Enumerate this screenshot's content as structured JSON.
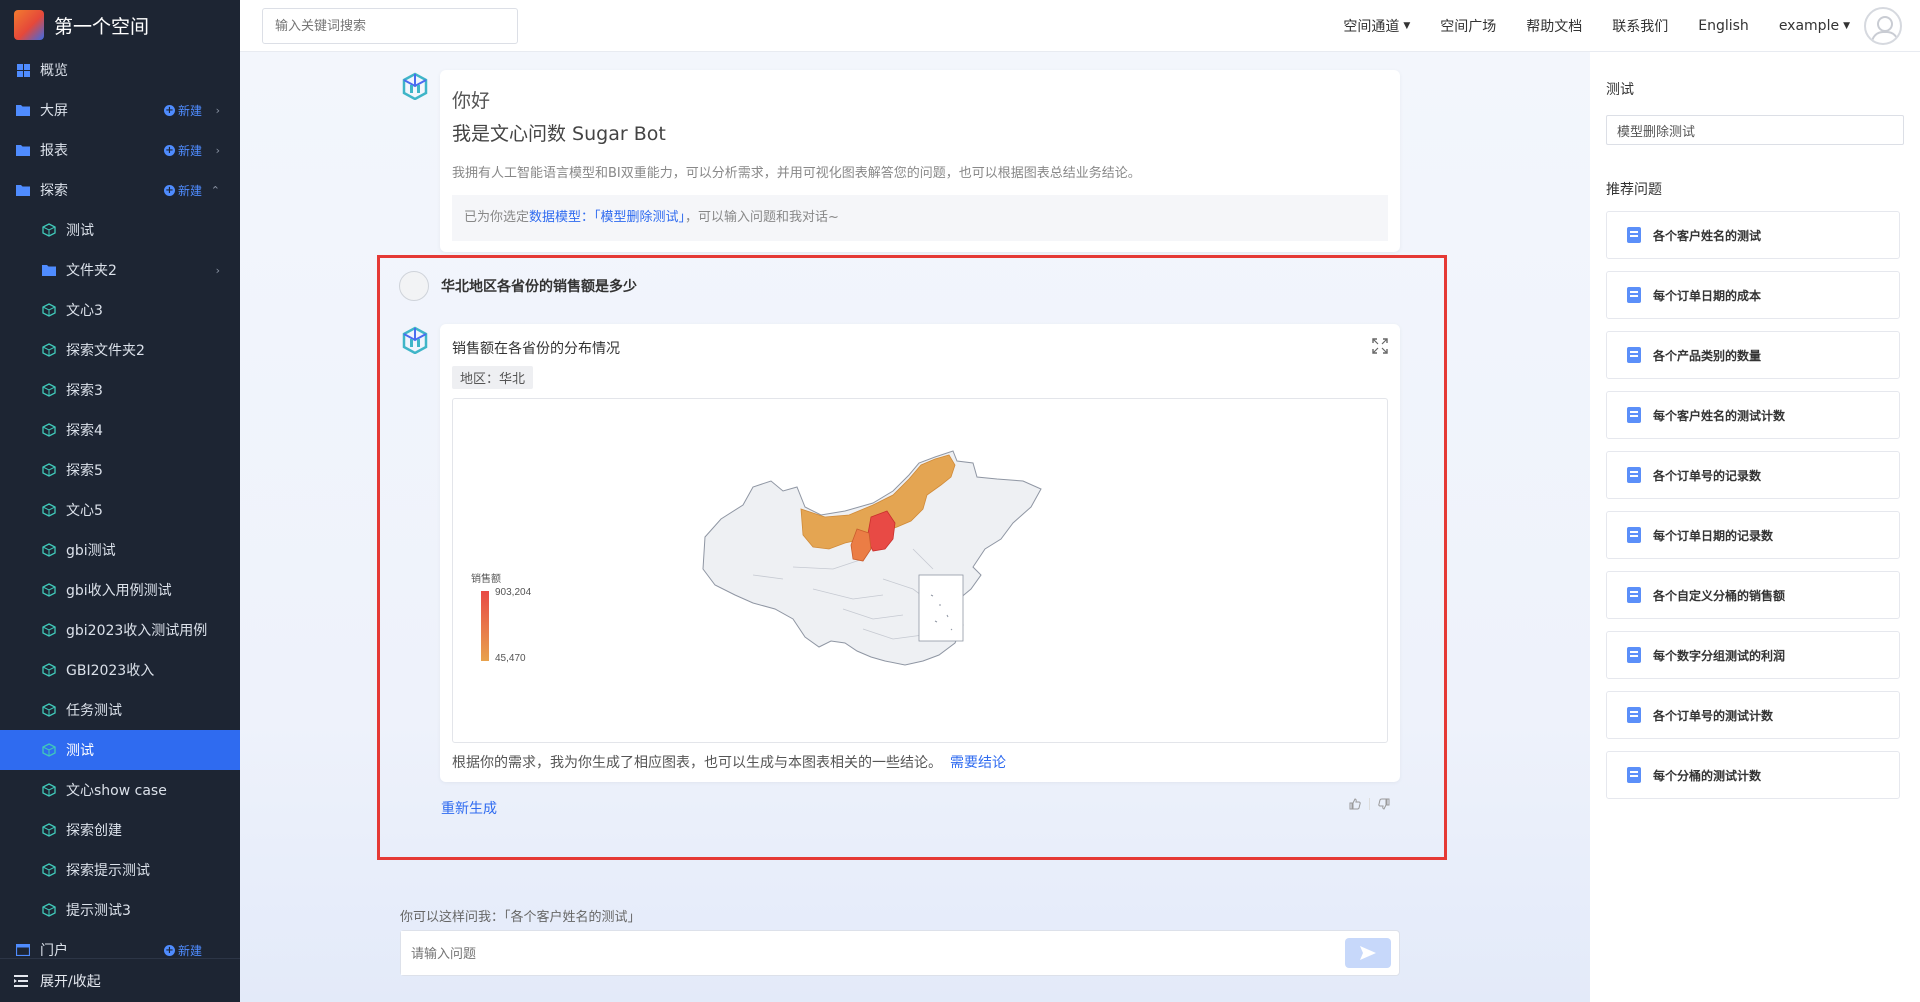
{
  "brand": {
    "title": "第一个空间"
  },
  "sidebar": {
    "items": [
      {
        "label": "概览",
        "icon": "grid-icon",
        "level": 0
      },
      {
        "label": "大屏",
        "icon": "folder-icon",
        "level": 0,
        "new": "新建",
        "chevron": "›"
      },
      {
        "label": "报表",
        "icon": "folder-icon",
        "level": 0,
        "new": "新建",
        "chevron": "›"
      },
      {
        "label": "探索",
        "icon": "folder-icon",
        "level": 0,
        "new": "新建",
        "chevron": "⌃",
        "expanded": true
      },
      {
        "label": "测试",
        "icon": "cube-icon",
        "level": 1
      },
      {
        "label": "文件夹2",
        "icon": "folder-icon",
        "level": 1,
        "chevron": "›"
      },
      {
        "label": "文心3",
        "icon": "cube-icon",
        "level": 1
      },
      {
        "label": "探索文件夹2",
        "icon": "cube-icon",
        "level": 1
      },
      {
        "label": "探索3",
        "icon": "cube-icon",
        "level": 1
      },
      {
        "label": "探索4",
        "icon": "cube-icon",
        "level": 1
      },
      {
        "label": "探索5",
        "icon": "cube-icon",
        "level": 1
      },
      {
        "label": "文心5",
        "icon": "cube-icon",
        "level": 1
      },
      {
        "label": "gbi测试",
        "icon": "cube-icon",
        "level": 1
      },
      {
        "label": "gbi收入用例测试",
        "icon": "cube-icon",
        "level": 1
      },
      {
        "label": "gbi2023收入测试用例",
        "icon": "cube-icon",
        "level": 1
      },
      {
        "label": "GBI2023收入",
        "icon": "cube-icon",
        "level": 1
      },
      {
        "label": "任务测试",
        "icon": "cube-icon",
        "level": 1
      },
      {
        "label": "测试",
        "icon": "cube-icon",
        "level": 1,
        "active": true
      },
      {
        "label": "文心show case",
        "icon": "cube-icon",
        "level": 1
      },
      {
        "label": "探索创建",
        "icon": "cube-icon",
        "level": 1
      },
      {
        "label": "探索提示测试",
        "icon": "cube-icon",
        "level": 1
      },
      {
        "label": "提示测试3",
        "icon": "cube-icon",
        "level": 1
      },
      {
        "label": "门户",
        "icon": "portal-icon",
        "level": 0,
        "new": "新建"
      }
    ],
    "footer": "展开/收起"
  },
  "topbar": {
    "search_placeholder": "输入关键词搜索",
    "links": [
      "空间通道",
      "空间广场",
      "帮助文档",
      "联系我们",
      "English",
      "example"
    ]
  },
  "greeting": {
    "hello": "你好",
    "bot": "我是文心问数 Sugar Bot",
    "desc": "我拥有人工智能语言模型和BI双重能力，可以分析需求，并用可视化图表解答您的问题，也可以根据图表总结业务结论。",
    "note_prefix": "已为你选定",
    "note_link": "数据模型：「模型删除测试」",
    "note_suffix": "，可以输入问题和我对话~"
  },
  "conversation": {
    "question": "华北地区各省份的销售额是多少",
    "chart_title": "销售额在各省份的分布情况",
    "filter_tag": "地区：华北",
    "legend_title": "销售额",
    "legend_max": "903,204",
    "legend_min": "45,470",
    "footer_text": "根据你的需求，我为你生成了相应图表，也可以生成与本图表相关的一些结论。",
    "footer_link": "需要结论",
    "regenerate": "重新生成"
  },
  "chart_data": {
    "type": "map",
    "title": "销售额在各省份的分布情况",
    "legend": {
      "title": "销售额",
      "max": 903204,
      "min": 45470
    },
    "highlighted_regions": [
      "内蒙古",
      "北京",
      "天津",
      "河北",
      "山西"
    ]
  },
  "input": {
    "hint": "你可以这样问我：「各个客户姓名的测试」",
    "placeholder": "请输入问题"
  },
  "right_panel": {
    "title": "测试",
    "model_value": "模型删除测试",
    "recommend_title": "推荐问题",
    "questions": [
      "各个客户姓名的测试",
      "每个订单日期的成本",
      "各个产品类别的数量",
      "每个客户姓名的测试计数",
      "各个订单号的记录数",
      "每个订单日期的记录数",
      "各个自定义分桶的销售额",
      "每个数字分组测试的利润",
      "各个订单号的测试计数",
      "每个分桶的测试计数"
    ]
  },
  "colors": {
    "accent": "#2f6bf0",
    "highlight": "#e53935",
    "map_high": "#e84a45",
    "map_low": "#e8a24d",
    "sidebar_bg": "#1d2533"
  }
}
